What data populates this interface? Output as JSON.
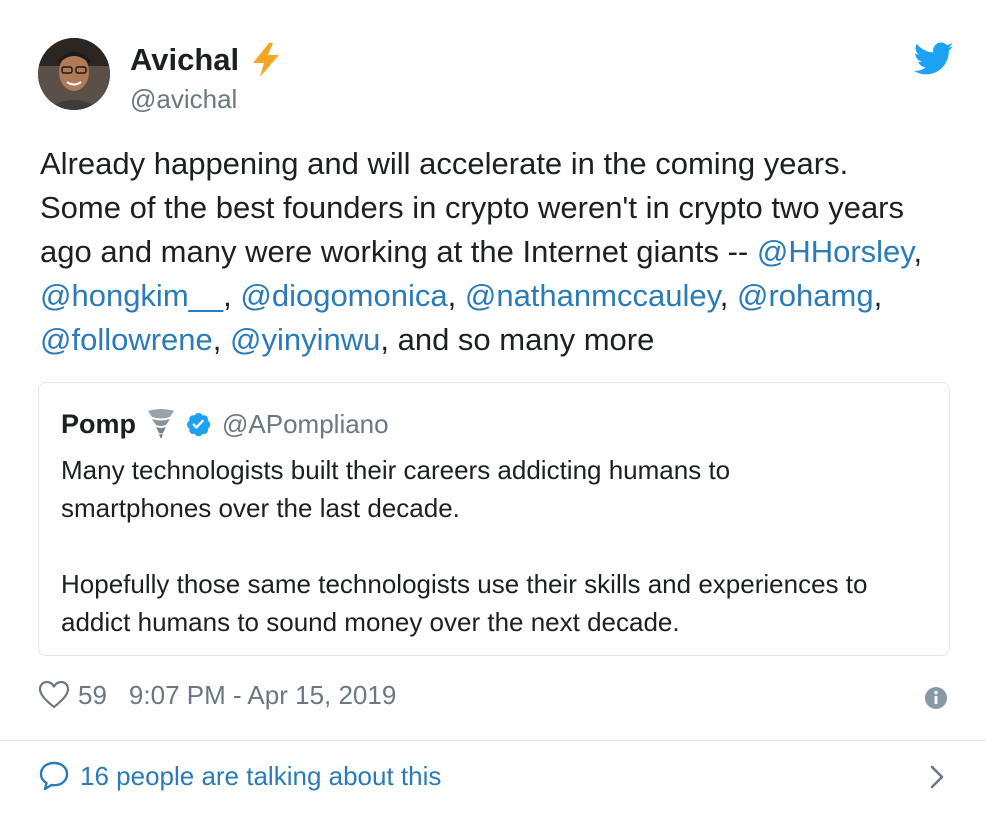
{
  "author": {
    "name": "Avichal",
    "handle": "@avichal",
    "name_emoji": "lightning-icon"
  },
  "tweet": {
    "lines": [
      [
        {
          "t": "Already happening and will accelerate in the coming years."
        }
      ],
      [
        {
          "t": "Some of the best founders in crypto weren't in crypto two years"
        }
      ],
      [
        {
          "t": "ago and many were working at the Internet giants -- "
        },
        {
          "t": "@HHorsley",
          "m": true
        },
        {
          "t": ","
        }
      ],
      [
        {
          "t": "@hongkim__",
          "m": true
        },
        {
          "t": ", "
        },
        {
          "t": "@diogomonica",
          "m": true
        },
        {
          "t": ", "
        },
        {
          "t": "@nathanmccauley",
          "m": true
        },
        {
          "t": ", "
        },
        {
          "t": "@rohamg",
          "m": true
        },
        {
          "t": ","
        }
      ],
      [
        {
          "t": "@followrene",
          "m": true
        },
        {
          "t": ", "
        },
        {
          "t": "@yinyinwu",
          "m": true
        },
        {
          "t": ", and so many more"
        }
      ]
    ]
  },
  "quote": {
    "name": "Pomp",
    "handle": "@APompliano",
    "verified": true,
    "para1": [
      "Many technologists built their careers addicting humans to",
      "smartphones over the last decade."
    ],
    "para2": [
      "Hopefully those same technologists use their skills and experiences to",
      "addict humans to sound money over the next decade."
    ]
  },
  "meta": {
    "likes": "59",
    "timestamp": "9:07 PM - Apr 15, 2019"
  },
  "footer": {
    "talking": "16 people are talking about this"
  },
  "colors": {
    "link": "#2b7bb9",
    "twitter_blue": "#1da1f2",
    "secondary_text": "#697882",
    "border": "#e1e8ed"
  }
}
